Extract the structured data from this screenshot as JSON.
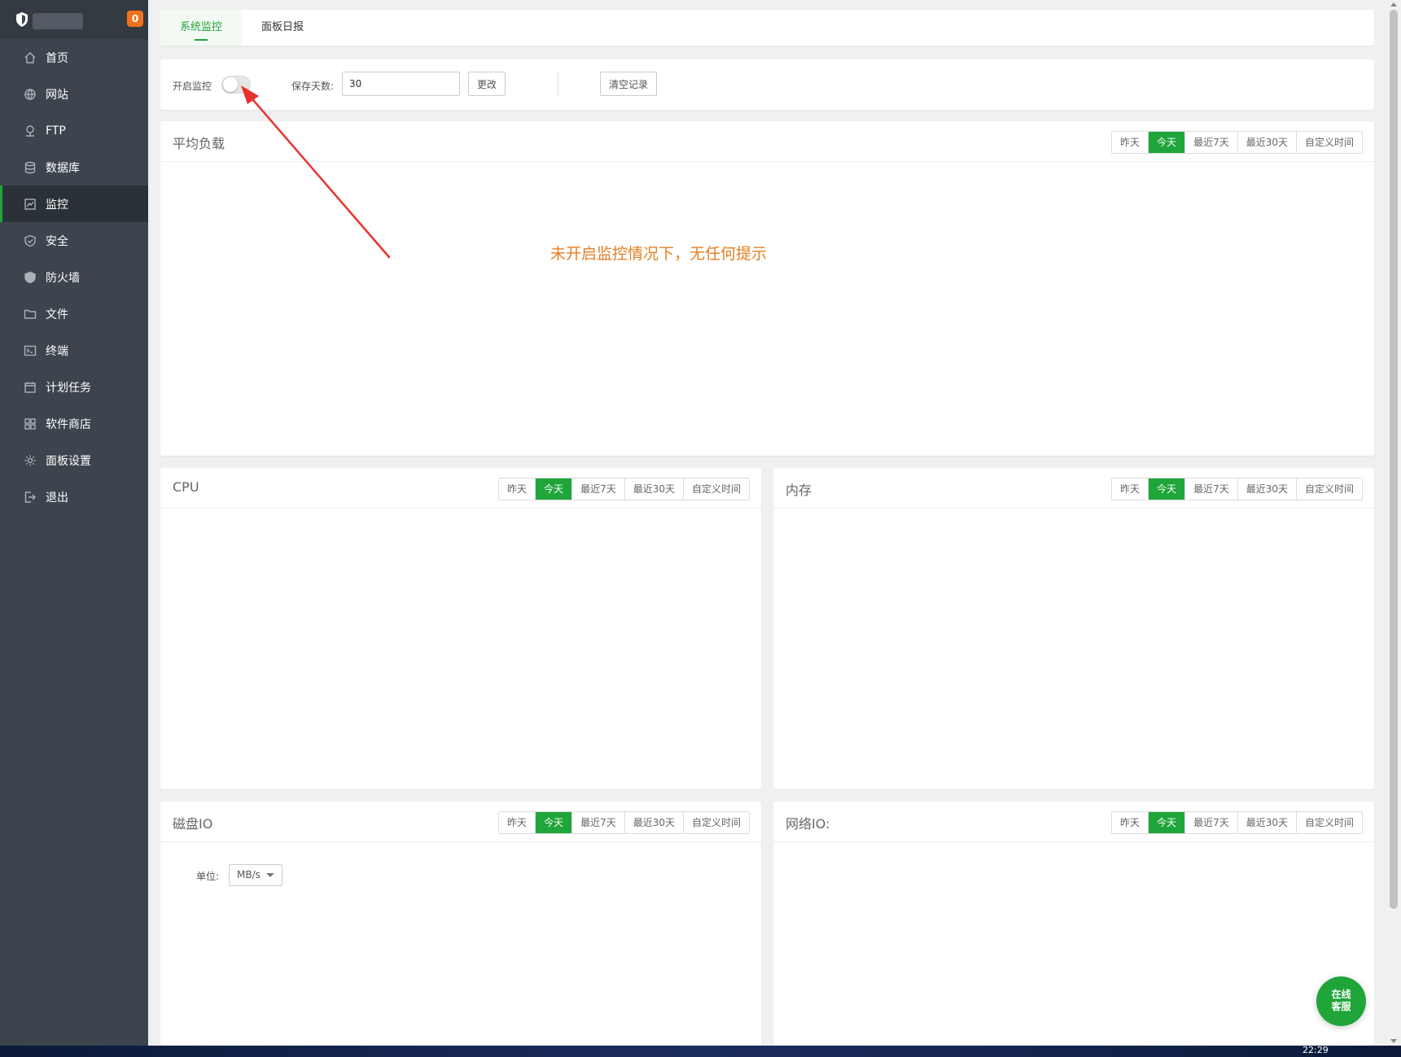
{
  "sidebar": {
    "badge": "0",
    "items": [
      {
        "label": "首页",
        "icon": "home-icon"
      },
      {
        "label": "网站",
        "icon": "globe-icon"
      },
      {
        "label": "FTP",
        "icon": "ftp-icon"
      },
      {
        "label": "数据库",
        "icon": "database-icon"
      },
      {
        "label": "监控",
        "icon": "monitor-icon",
        "active": true
      },
      {
        "label": "安全",
        "icon": "shield-check-icon"
      },
      {
        "label": "防火墙",
        "icon": "firewall-icon"
      },
      {
        "label": "文件",
        "icon": "folder-icon"
      },
      {
        "label": "终端",
        "icon": "terminal-icon"
      },
      {
        "label": "计划任务",
        "icon": "calendar-icon"
      },
      {
        "label": "软件商店",
        "icon": "grid-icon"
      },
      {
        "label": "面板设置",
        "icon": "gear-icon"
      },
      {
        "label": "退出",
        "icon": "logout-icon"
      }
    ]
  },
  "tabs": {
    "system_monitor": "系统监控",
    "daily_report": "面板日报"
  },
  "controls": {
    "enable_label": "开启监控",
    "enabled": false,
    "days_label": "保存天数:",
    "days_value": "30",
    "change_button": "更改",
    "clear_button": "清空记录"
  },
  "ranges": [
    "昨天",
    "今天",
    "最近7天",
    "最近30天",
    "自定义时间"
  ],
  "selected_range": "今天",
  "panels": {
    "load_title": "平均负载",
    "cpu_title": "CPU",
    "mem_title": "内存",
    "disk_title": "磁盘IO",
    "net_title": "网络IO:"
  },
  "annotation": "未开启监控情况下，无任何提示",
  "disk_unit": {
    "label": "单位:",
    "value": "MB/s"
  },
  "fab": {
    "line1": "在线",
    "line2": "客服"
  },
  "taskbar": {
    "time": "22:29"
  },
  "colors": {
    "accent": "#20a53a",
    "annotation": "#e67e22",
    "arrow": "#e8322d",
    "sidebar": "#3c444d",
    "badge": "#f2711c"
  }
}
